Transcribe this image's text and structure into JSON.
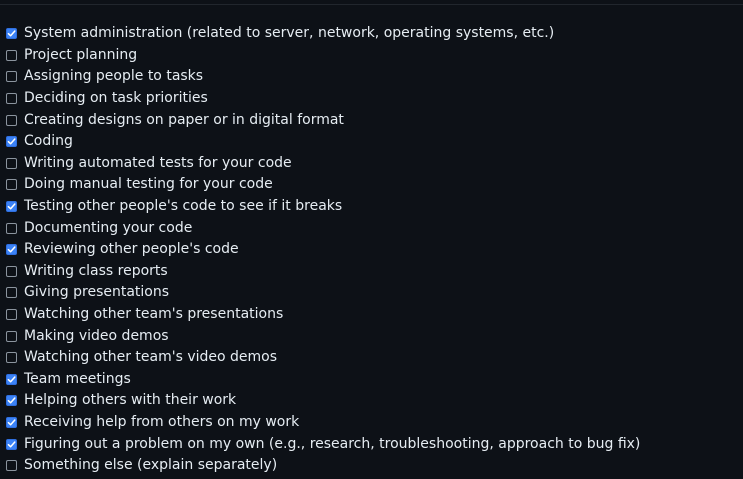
{
  "checklist": {
    "items": [
      {
        "label": "System administration (related to server, network, operating systems, etc.)",
        "checked": true
      },
      {
        "label": "Project planning",
        "checked": false
      },
      {
        "label": "Assigning people to tasks",
        "checked": false
      },
      {
        "label": "Deciding on task priorities",
        "checked": false
      },
      {
        "label": "Creating designs on paper or in digital format",
        "checked": false
      },
      {
        "label": "Coding",
        "checked": true
      },
      {
        "label": "Writing automated tests for your code",
        "checked": false
      },
      {
        "label": "Doing manual testing for your code",
        "checked": false
      },
      {
        "label": "Testing other people's code to see if it breaks",
        "checked": true
      },
      {
        "label": "Documenting your code",
        "checked": false
      },
      {
        "label": "Reviewing other people's code",
        "checked": true
      },
      {
        "label": "Writing class reports",
        "checked": false
      },
      {
        "label": "Giving presentations",
        "checked": false
      },
      {
        "label": "Watching other team's presentations",
        "checked": false
      },
      {
        "label": "Making video demos",
        "checked": false
      },
      {
        "label": "Watching other team's video demos",
        "checked": false
      },
      {
        "label": "Team meetings",
        "checked": true
      },
      {
        "label": "Helping others with their work",
        "checked": true
      },
      {
        "label": "Receiving help from others on my work",
        "checked": true
      },
      {
        "label": "Figuring out a problem on my own (e.g., research, troubleshooting, approach to bug fix)",
        "checked": true
      },
      {
        "label": "Something else (explain separately)",
        "checked": false
      }
    ]
  },
  "colors": {
    "background": "#0d1117",
    "text": "#e6edf3",
    "checkbox_checked": "#3b82f6"
  }
}
